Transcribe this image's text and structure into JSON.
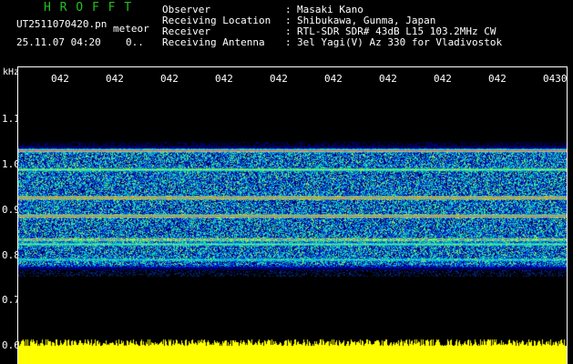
{
  "app_title": "H R O F F T",
  "file_name": "UT2511070420.pn",
  "meteor_label": "meteor",
  "timestamp": "25.11.07 04:20",
  "count": "0..",
  "info": [
    {
      "label": "Observer",
      "value": "Masaki Kano"
    },
    {
      "label": "Receiving Location",
      "value": "Shibukawa, Gunma, Japan"
    },
    {
      "label": "Receiver",
      "value": "RTL-SDR SDR# 43dB L15 103.2MHz CW"
    },
    {
      "label": "Receiving Antenna",
      "value": "3el Yagi(V) Az 330 for Vladivostok"
    }
  ],
  "info_separator": ":",
  "axis": {
    "unit": "kHz",
    "y_ticks": [
      "1.1",
      "1.0",
      "0.9",
      "0.8",
      "0.7",
      "0.6"
    ],
    "time_ticks": [
      "042",
      "042",
      "042",
      "042",
      "042",
      "042",
      "042",
      "042",
      "042",
      "0430"
    ]
  },
  "colors": {
    "background": "#000000",
    "title": "#22c022",
    "text": "#ffffff",
    "signal_low": "#0000a0",
    "signal_mid": "#00c8c8",
    "signal_high": "#ff2060",
    "meter": "#ffff00"
  }
}
